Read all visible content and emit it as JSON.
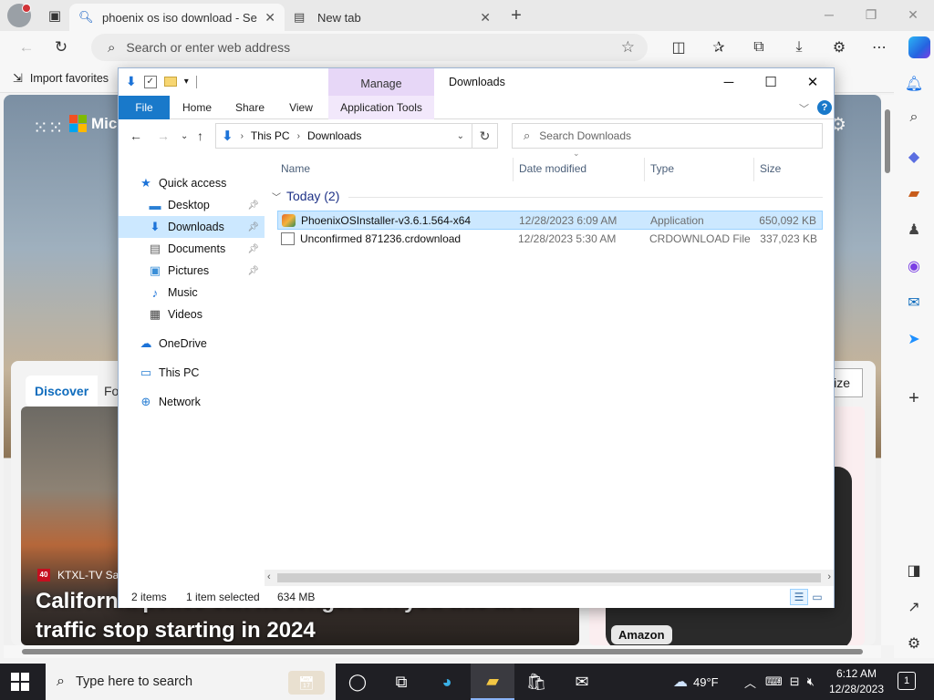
{
  "browser": {
    "tabs": [
      {
        "title": "phoenix os iso download - Search",
        "active": true
      },
      {
        "title": "New tab",
        "active": false
      }
    ],
    "address_placeholder": "Search or enter web address",
    "favorites_bar": {
      "import_label": "Import favorites"
    }
  },
  "page": {
    "msn_name": "Mic",
    "feed_tabs": {
      "discover": "Discover",
      "next": "Fo",
      "personalize": "lize"
    },
    "news": {
      "source": "KTXL-TV Sac",
      "source_badge": "40",
      "headline": "California police can no longer ask you this at a traffic stop starting in 2024"
    },
    "promo": {
      "badge": "Amazon"
    }
  },
  "explorer": {
    "window_title": "Downloads",
    "manage_label": "Manage",
    "ribbon_tabs": [
      "File",
      "Home",
      "Share",
      "View",
      "Application Tools"
    ],
    "breadcrumb": [
      "This PC",
      "Downloads"
    ],
    "search_placeholder": "Search Downloads",
    "nav": [
      {
        "label": "Quick access",
        "icon": "star-icon",
        "pinned": false
      },
      {
        "label": "Desktop",
        "icon": "desktop-icon",
        "pinned": true
      },
      {
        "label": "Downloads",
        "icon": "downloads-icon",
        "pinned": true,
        "selected": true
      },
      {
        "label": "Documents",
        "icon": "documents-icon",
        "pinned": true
      },
      {
        "label": "Pictures",
        "icon": "pictures-icon",
        "pinned": true
      },
      {
        "label": "Music",
        "icon": "music-icon",
        "pinned": false
      },
      {
        "label": "Videos",
        "icon": "videos-icon",
        "pinned": false
      },
      {
        "label": "OneDrive",
        "icon": "cloud-icon",
        "pinned": false
      },
      {
        "label": "This PC",
        "icon": "computer-icon",
        "pinned": false
      },
      {
        "label": "Network",
        "icon": "network-icon",
        "pinned": false
      }
    ],
    "columns": [
      "Name",
      "Date modified",
      "Type",
      "Size"
    ],
    "group": "Today (2)",
    "files": [
      {
        "name": "PhoenixOSInstaller-v3.6.1.564-x64",
        "date": "12/28/2023 6:09 AM",
        "type": "Application",
        "size": "650,092 KB",
        "selected": true
      },
      {
        "name": "Unconfirmed 871236.crdownload",
        "date": "12/28/2023 5:30 AM",
        "type": "CRDOWNLOAD File",
        "size": "337,023 KB",
        "selected": false
      }
    ],
    "status": {
      "items": "2 items",
      "selected": "1 item selected",
      "size": "634 MB"
    }
  },
  "taskbar": {
    "search_placeholder": "Type here to search",
    "weather": "49°F",
    "time": "6:12 AM",
    "date": "12/28/2023",
    "notifications": "1"
  },
  "colors": {
    "accent": "#1979ca",
    "selection": "#cce8ff",
    "manage_tab": "#e7d7f7",
    "taskbar": "#1f1f24"
  }
}
